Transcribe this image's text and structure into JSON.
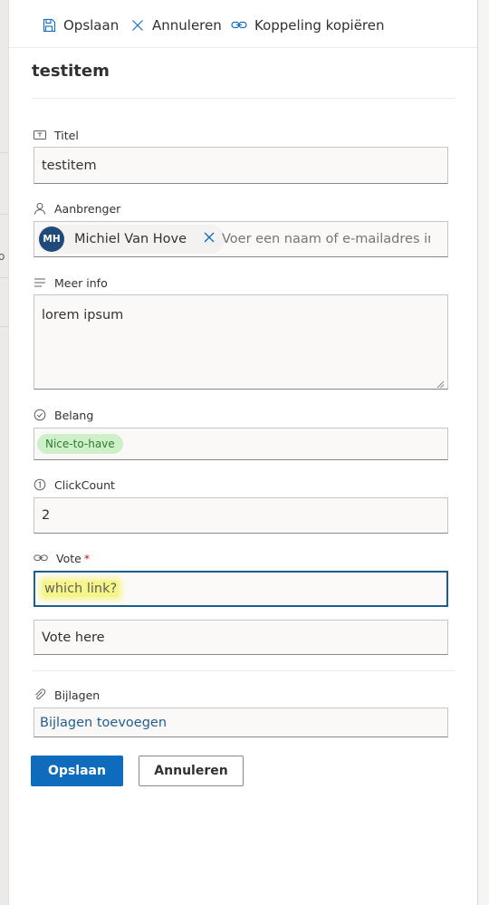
{
  "commands": {
    "save": "Opslaan",
    "cancel": "Annuleren",
    "copy_link": "Koppeling kopiëren"
  },
  "item_title": "testitem",
  "fields": {
    "title": {
      "label": "Titel",
      "value": "testitem"
    },
    "submitter": {
      "label": "Aanbrenger",
      "person": {
        "initials": "MH",
        "name": "Michiel Van Hove"
      },
      "placeholder": "Voer een naam of e-mailadres in"
    },
    "more_info": {
      "label": "Meer info",
      "value": "lorem ipsum"
    },
    "importance": {
      "label": "Belang",
      "value": "Nice-to-have"
    },
    "click_count": {
      "label": "ClickCount",
      "value": "2"
    },
    "vote": {
      "label": "Vote",
      "required_mark": "*",
      "url_value": "which link?",
      "description_value": "Vote here"
    },
    "attachments": {
      "label": "Bijlagen",
      "add_link": "Bijlagen toevoegen"
    }
  },
  "footer": {
    "save": "Opslaan",
    "cancel": "Annuleren"
  },
  "left_edge_text": "o",
  "colors": {
    "primary": "#0f6cbd",
    "focus_border": "#1b5e8e",
    "tag_bg": "#cdf0c8",
    "tag_text": "#2f7a2f",
    "avatar_bg": "#1f4a7a",
    "highlight": "#f5f58a",
    "link": "#1f5d93"
  },
  "icons": {
    "save": "save-icon",
    "cancel": "close-icon",
    "copy_link": "link-icon",
    "title": "text-field-icon",
    "submitter": "person-icon",
    "more_info": "multiline-text-icon",
    "importance": "choice-icon",
    "click_count": "number-icon",
    "vote": "link-icon",
    "attachments": "paperclip-icon"
  }
}
